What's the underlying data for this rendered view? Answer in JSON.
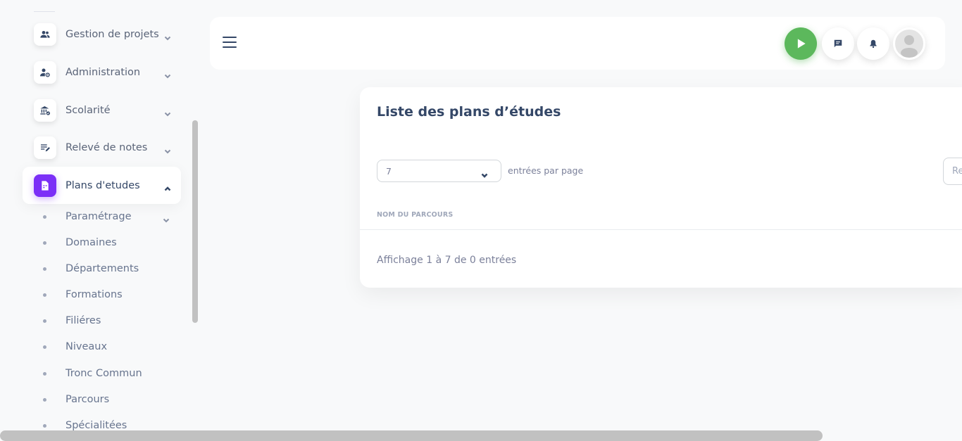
{
  "sidebar": {
    "items": [
      {
        "label": "Gestion de projets",
        "icon": "people-icon"
      },
      {
        "label": "Administration",
        "icon": "user-gear-icon"
      },
      {
        "label": "Scolarité",
        "icon": "bank-check-icon"
      },
      {
        "label": "Relevé de notes",
        "icon": "edit-list-icon"
      },
      {
        "label": "Plans d'etudes",
        "icon": "document-icon",
        "active": true
      }
    ],
    "sub_items": [
      {
        "label": "Paramétrage"
      },
      {
        "label": "Domaines"
      },
      {
        "label": "Départements"
      },
      {
        "label": "Formations"
      },
      {
        "label": "Filiéres"
      },
      {
        "label": "Niveaux"
      },
      {
        "label": "Tronc Commun"
      },
      {
        "label": "Parcours"
      },
      {
        "label": "Spécialitées"
      }
    ]
  },
  "header": {
    "menu_icon": "hamburger-icon",
    "play_icon": "play-icon",
    "chat_icon": "chat-icon",
    "bell_icon": "bell-icon",
    "avatar_icon": "user-avatar-icon",
    "play_color": "#5cb85c"
  },
  "card": {
    "title": "Liste des plans d’études",
    "page_size": "7",
    "entries_label": "entrées par page",
    "search_placeholder": "Rechercher...",
    "column_header": "NOM DU PARCOURS",
    "info": "Affichage 1 à 7 de 0 entrées"
  },
  "colors": {
    "accent": "#7b2ff7",
    "text_primary": "#344767",
    "background": "#f8f9fa"
  }
}
